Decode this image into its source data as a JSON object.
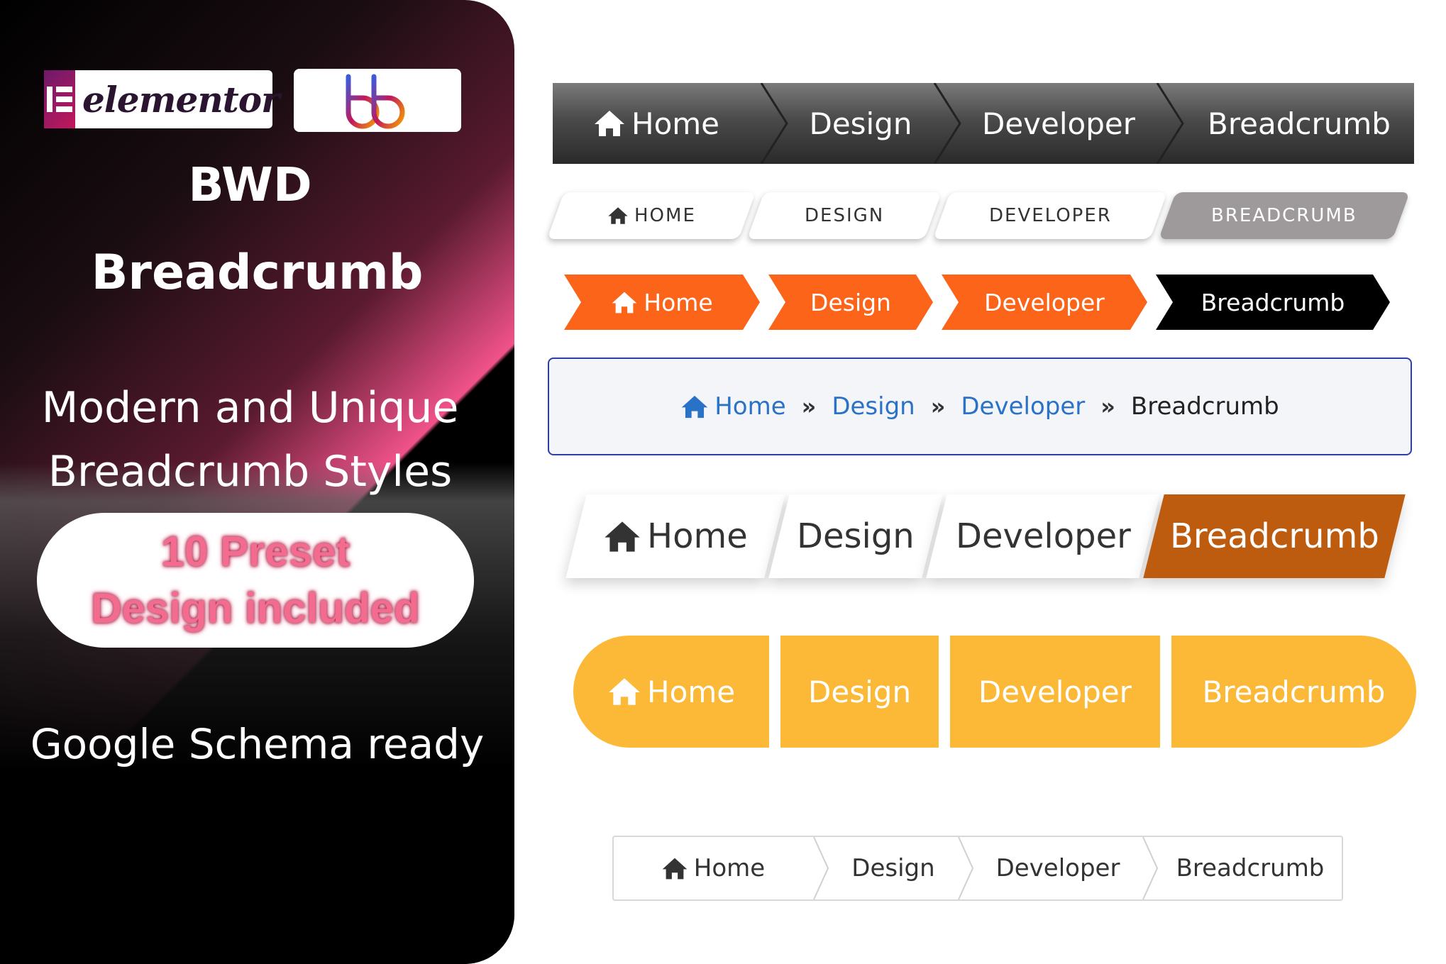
{
  "left_panel": {
    "logos": {
      "elementor_mark": "IE",
      "elementor_word": "elementor",
      "bb_mark": "bb"
    },
    "title_line1": "BWD",
    "title_line2": "Breadcrumb",
    "subtitle_line1": "Modern and Unique",
    "subtitle_line2": "Breadcrumb Styles",
    "pill_line1": "10 Preset",
    "pill_line2": "Design included",
    "schema_text": "Google Schema ready"
  },
  "breadcrumb_items": [
    "Home",
    "Design",
    "Developer",
    "Breadcrumb"
  ],
  "breadcrumb_items_upper": [
    "HOME",
    "DESIGN",
    "DEVELOPER",
    "BREADCRUMB"
  ],
  "icons": {
    "home": "home-icon",
    "separator": "double-chevron-icon"
  },
  "colors": {
    "style1_bg": "#4a4a4a",
    "style2_active": "#9e9a9b",
    "style3_orange": "#fb6419",
    "style3_active": "#000000",
    "style4_link": "#2a72c8",
    "style4_border": "#2e3fa8",
    "style5_active": "#bd5b0f",
    "style6_yellow": "#fbb937",
    "panel_pink": "#f0528a"
  }
}
